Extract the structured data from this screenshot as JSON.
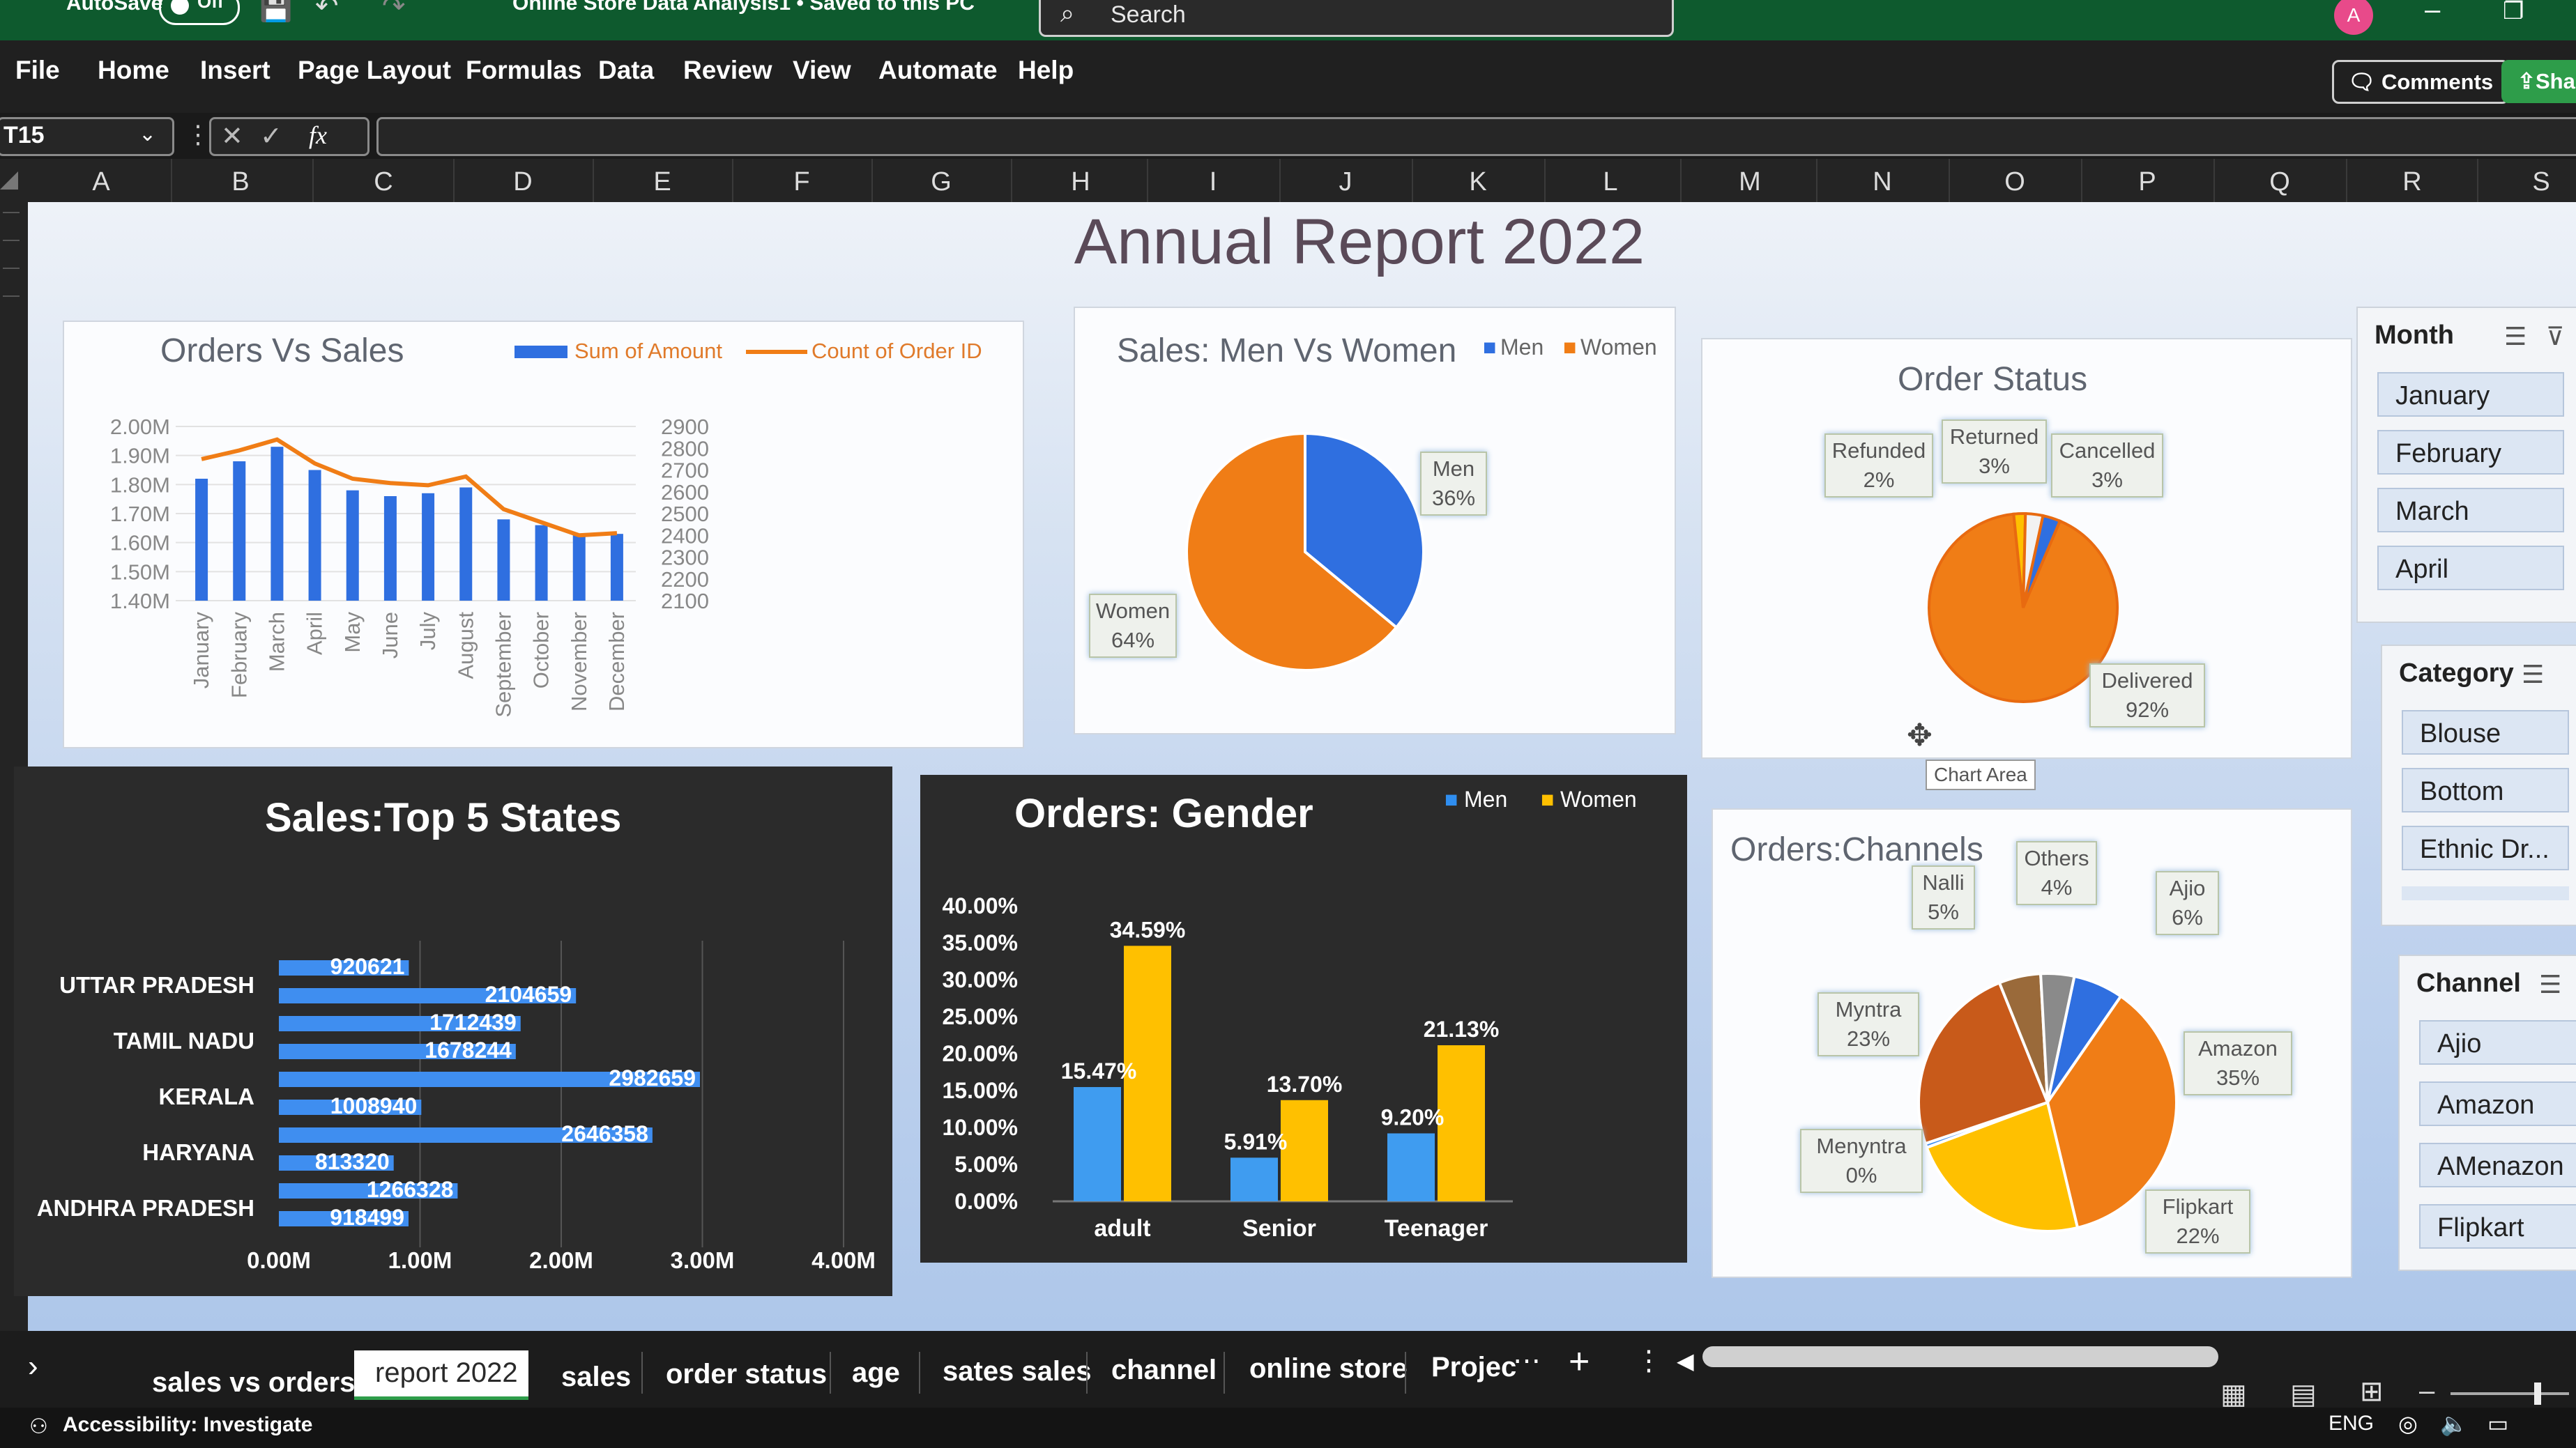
{
  "titlebar": {
    "autosave": "AutoSave",
    "toggle": "Off",
    "doc_title": "Online Store Data Analysis1 • Saved to this PC",
    "search": "Search",
    "avatar": "A"
  },
  "menu": [
    "File",
    "Home",
    "Insert",
    "Page Layout",
    "Formulas",
    "Data",
    "Review",
    "View",
    "Automate",
    "Help"
  ],
  "menu_right": {
    "comments": "Comments",
    "share": "Shar"
  },
  "formula": {
    "cell_ref": "T15",
    "fx": "fx"
  },
  "columns": [
    "A",
    "B",
    "C",
    "D",
    "E",
    "F",
    "G",
    "H",
    "I",
    "J",
    "K",
    "L",
    "M",
    "N",
    "O",
    "P",
    "Q",
    "R",
    "S"
  ],
  "report_title": "Annual Report 2022",
  "colors": {
    "blue": "#2f6fe0",
    "orange": "#f07d16",
    "yellow": "#ffc000",
    "dark_panel": "#2b2b2b"
  },
  "orders_vs_sales": {
    "title": "Orders Vs Sales",
    "legend": [
      "Sum of Amount",
      "Count of Order ID"
    ],
    "chart_data": {
      "type": "bar",
      "categories": [
        "January",
        "February",
        "March",
        "April",
        "May",
        "June",
        "July",
        "August",
        "September",
        "October",
        "November",
        "December"
      ],
      "series": [
        {
          "name": "Sum of Amount",
          "values": [
            1.82,
            1.88,
            1.93,
            1.85,
            1.78,
            1.76,
            1.77,
            1.79,
            1.68,
            1.66,
            1.63,
            1.63
          ]
        },
        {
          "name": "Count of Order ID",
          "values": [
            2750,
            2790,
            2840,
            2730,
            2660,
            2640,
            2630,
            2670,
            2520,
            2460,
            2400,
            2410
          ]
        }
      ],
      "y_left_ticks": [
        "2.00M",
        "1.90M",
        "1.80M",
        "1.70M",
        "1.60M",
        "1.50M",
        "1.40M"
      ],
      "y_right_ticks": [
        "2900",
        "2800",
        "2700",
        "2600",
        "2500",
        "2400",
        "2300",
        "2200",
        "2100"
      ],
      "ylim_left": [
        1.4,
        2.0
      ],
      "ylim_right": [
        2100,
        2900
      ]
    }
  },
  "sales_gender": {
    "title": "Sales: Men Vs Women",
    "legend": [
      "Men",
      "Women"
    ],
    "chart_data": {
      "type": "pie",
      "labels": [
        "Men",
        "Women"
      ],
      "values": [
        36,
        64
      ],
      "display": [
        "36%",
        "64%"
      ]
    }
  },
  "order_status": {
    "title": "Order Status",
    "chart_data": {
      "type": "pie",
      "labels": [
        "Delivered",
        "Refunded",
        "Returned",
        "Cancelled"
      ],
      "values": [
        92,
        2,
        3,
        3
      ],
      "display": [
        "92%",
        "2%",
        "3%",
        "3%"
      ]
    },
    "tooltip": "Chart Area"
  },
  "top_states": {
    "title": "Sales:Top 5 States",
    "chart_data": {
      "type": "bar",
      "categories": [
        "UTTAR PRADESH",
        "TAMIL NADU",
        "KERALA",
        "HARYANA",
        "ANDHRA PRADESH"
      ],
      "bars": [
        920621,
        2104659,
        1712439,
        1678244,
        2982659,
        1008940,
        2646358,
        813320,
        1266328,
        918499
      ],
      "x_ticks": [
        "0.00M",
        "1.00M",
        "2.00M",
        "3.00M",
        "4.00M"
      ],
      "xlim": [
        0,
        4000000
      ]
    }
  },
  "orders_gender": {
    "title": "Orders: Gender",
    "legend": [
      "Men",
      "Women"
    ],
    "chart_data": {
      "type": "bar",
      "categories": [
        "adult",
        "Senior",
        "Teenager"
      ],
      "series": [
        {
          "name": "Men",
          "values": [
            15.47,
            5.91,
            9.2
          ],
          "labels": [
            "15.47%",
            "5.91%",
            "9.20%"
          ]
        },
        {
          "name": "Women",
          "values": [
            34.59,
            13.7,
            21.13
          ],
          "labels": [
            "34.59%",
            "13.70%",
            "21.13%"
          ]
        }
      ],
      "y_ticks": [
        "40.00%",
        "35.00%",
        "30.00%",
        "25.00%",
        "20.00%",
        "15.00%",
        "10.00%",
        "5.00%",
        "0.00%"
      ],
      "ylim": [
        0,
        40
      ]
    }
  },
  "channels": {
    "title": "Orders:Channels",
    "chart_data": {
      "type": "pie",
      "labels": [
        "Amazon",
        "Flipkart",
        "Menyntra",
        "Myntra",
        "Nalli",
        "Others",
        "Ajio"
      ],
      "values": [
        35,
        22,
        0.5,
        23,
        5,
        4,
        6
      ],
      "display": [
        "35%",
        "22%",
        "0%",
        "23%",
        "5%",
        "4%",
        "6%"
      ]
    }
  },
  "slicers": {
    "month": {
      "title": "Month",
      "items": [
        "January",
        "February",
        "March",
        "April"
      ]
    },
    "category": {
      "title": "Category",
      "items": [
        "Blouse",
        "Bottom",
        "Ethnic Dr..."
      ]
    },
    "channel": {
      "title": "Channel",
      "items": [
        "Ajio",
        "Amazon",
        "AMenazon",
        "Flipkart"
      ]
    }
  },
  "tabs": [
    "sales vs orders",
    "report 2022",
    "sales",
    "order status",
    "age",
    "sates sales",
    "channel",
    "online store",
    "Projec"
  ],
  "active_tab": "report 2022",
  "status": {
    "accessibility": "Accessibility: Investigate",
    "lang": "ENG"
  }
}
